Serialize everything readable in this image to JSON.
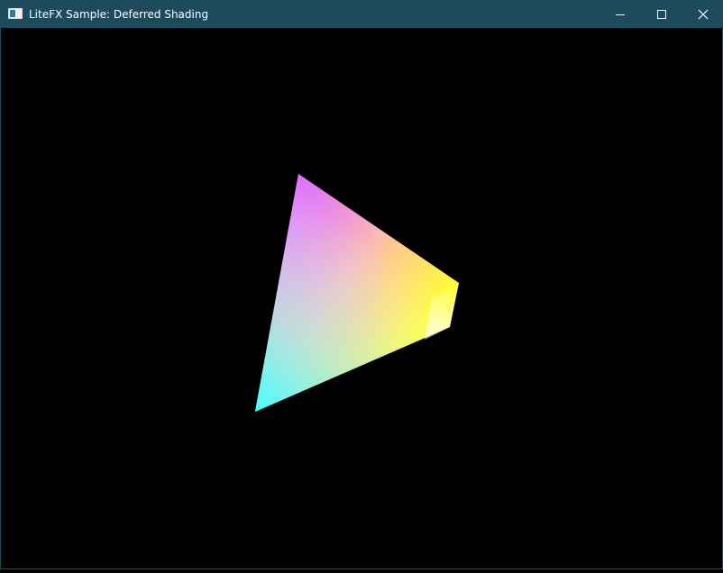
{
  "window": {
    "title": "LiteFX Sample: Deferred Shading",
    "icon": "app-window-icon",
    "controls": [
      "minimize-icon",
      "maximize-icon",
      "close-icon"
    ],
    "titlebar_color": "#1d4b5b"
  },
  "scene": {
    "background_color": "#000000",
    "vertex_colors": [
      "#ff40ff",
      "#ffff30",
      "#ffffff",
      "#40ffff"
    ]
  }
}
